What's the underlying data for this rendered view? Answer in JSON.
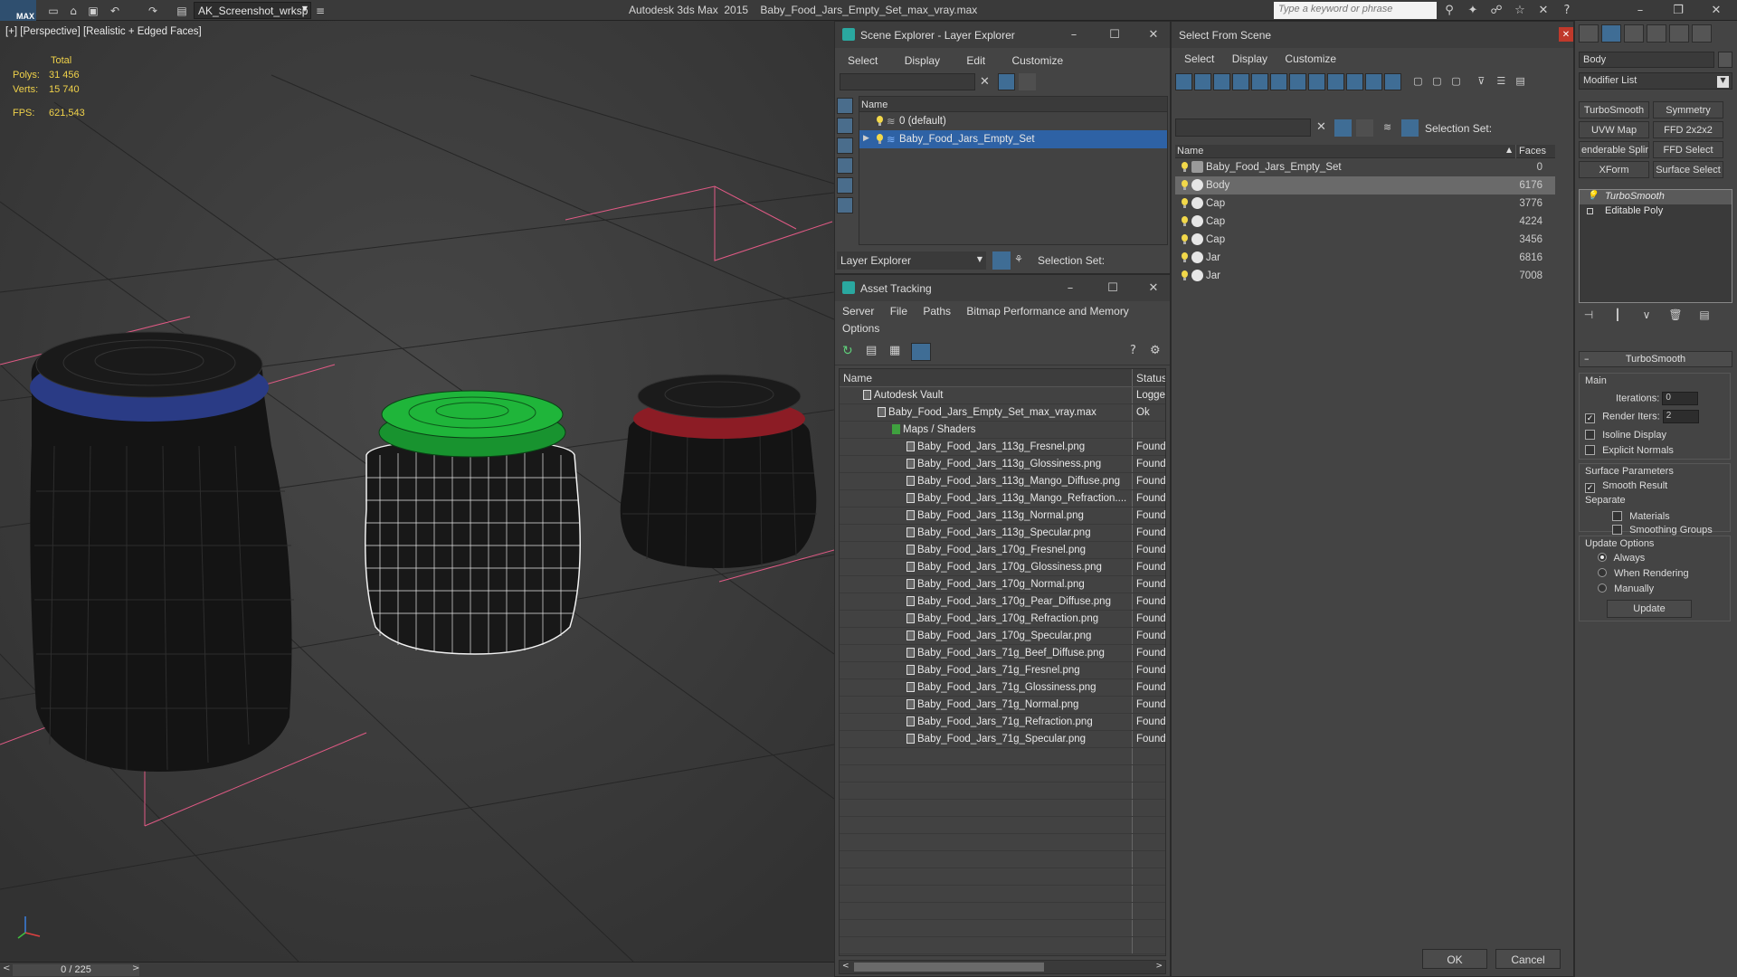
{
  "app": {
    "logo": "MAX",
    "window_title": "Autodesk 3ds Max  2015    Baby_Food_Jars_Empty_Set_max_vray.max",
    "workspace": "AK_Screenshot_wrksp",
    "search_placeholder": "Type a keyword or phrase"
  },
  "viewport": {
    "label": "[+] [Perspective] [Realistic + Edged Faces]",
    "stats": {
      "total_label": "Total",
      "polys_label": "Polys:",
      "polys": "31 456",
      "verts_label": "Verts:",
      "verts": "15 740",
      "fps_label": "FPS:",
      "fps": "621,543"
    },
    "timeline": "0 / 225"
  },
  "scene_explorer": {
    "title": "Scene Explorer - Layer Explorer",
    "menu": [
      "Select",
      "Display",
      "Edit",
      "Customize"
    ],
    "column_name": "Name",
    "layers": [
      {
        "label": "0 (default)",
        "selected": false
      },
      {
        "label": "Baby_Food_Jars_Empty_Set",
        "selected": true
      }
    ],
    "footer_dropdown": "Layer Explorer",
    "selection_set_label": "Selection Set:"
  },
  "asset_tracking": {
    "title": "Asset Tracking",
    "menu_row1": [
      "Server",
      "File",
      "Paths",
      "Bitmap Performance and Memory"
    ],
    "menu_row2": [
      "Options"
    ],
    "columns": {
      "name": "Name",
      "status": "Status"
    },
    "rows": [
      {
        "name": "Autodesk Vault",
        "status": "Logged",
        "level": 0
      },
      {
        "name": "Baby_Food_Jars_Empty_Set_max_vray.max",
        "status": "Ok",
        "level": 1
      },
      {
        "name": "Maps / Shaders",
        "status": "",
        "level": 2
      },
      {
        "name": "Baby_Food_Jars_113g_Fresnel.png",
        "status": "Found",
        "level": 3
      },
      {
        "name": "Baby_Food_Jars_113g_Glossiness.png",
        "status": "Found",
        "level": 3
      },
      {
        "name": "Baby_Food_Jars_113g_Mango_Diffuse.png",
        "status": "Found",
        "level": 3
      },
      {
        "name": "Baby_Food_Jars_113g_Mango_Refraction....",
        "status": "Found",
        "level": 3
      },
      {
        "name": "Baby_Food_Jars_113g_Normal.png",
        "status": "Found",
        "level": 3
      },
      {
        "name": "Baby_Food_Jars_113g_Specular.png",
        "status": "Found",
        "level": 3
      },
      {
        "name": "Baby_Food_Jars_170g_Fresnel.png",
        "status": "Found",
        "level": 3
      },
      {
        "name": "Baby_Food_Jars_170g_Glossiness.png",
        "status": "Found",
        "level": 3
      },
      {
        "name": "Baby_Food_Jars_170g_Normal.png",
        "status": "Found",
        "level": 3
      },
      {
        "name": "Baby_Food_Jars_170g_Pear_Diffuse.png",
        "status": "Found",
        "level": 3
      },
      {
        "name": "Baby_Food_Jars_170g_Refraction.png",
        "status": "Found",
        "level": 3
      },
      {
        "name": "Baby_Food_Jars_170g_Specular.png",
        "status": "Found",
        "level": 3
      },
      {
        "name": "Baby_Food_Jars_71g_Beef_Diffuse.png",
        "status": "Found",
        "level": 3
      },
      {
        "name": "Baby_Food_Jars_71g_Fresnel.png",
        "status": "Found",
        "level": 3
      },
      {
        "name": "Baby_Food_Jars_71g_Glossiness.png",
        "status": "Found",
        "level": 3
      },
      {
        "name": "Baby_Food_Jars_71g_Normal.png",
        "status": "Found",
        "level": 3
      },
      {
        "name": "Baby_Food_Jars_71g_Refraction.png",
        "status": "Found",
        "level": 3
      },
      {
        "name": "Baby_Food_Jars_71g_Specular.png",
        "status": "Found",
        "level": 3
      }
    ]
  },
  "select_from_scene": {
    "title": "Select From Scene",
    "menu": [
      "Select",
      "Display",
      "Customize"
    ],
    "selection_set_label": "Selection Set:",
    "columns": {
      "name": "Name",
      "faces": "Faces"
    },
    "rows": [
      {
        "name": "Baby_Food_Jars_Empty_Set",
        "faces": "0",
        "selected": false
      },
      {
        "name": "Body",
        "faces": "6176",
        "selected": true
      },
      {
        "name": "Cap",
        "faces": "3776",
        "selected": false
      },
      {
        "name": "Cap",
        "faces": "4224",
        "selected": false
      },
      {
        "name": "Cap",
        "faces": "3456",
        "selected": false
      },
      {
        "name": "Jar",
        "faces": "6816",
        "selected": false
      },
      {
        "name": "Jar",
        "faces": "7008",
        "selected": false
      }
    ],
    "ok_label": "OK",
    "cancel_label": "Cancel"
  },
  "command_panel": {
    "object_name": "Body",
    "modifier_list": "Modifier List",
    "modifier_buttons": [
      "TurboSmooth",
      "Symmetry",
      "UVW Map",
      "FFD 2x2x2",
      "enderable Splir",
      "FFD Select",
      "XForm",
      "Surface Select"
    ],
    "stack": [
      "TurboSmooth",
      "Editable Poly"
    ],
    "turbosmooth": {
      "title": "TurboSmooth",
      "main_label": "Main",
      "iterations_label": "Iterations:",
      "iterations": "0",
      "render_iters_label": "Render Iters:",
      "render_iters": "2",
      "isoline_label": "Isoline Display",
      "explicit_normals_label": "Explicit Normals",
      "surface_params_label": "Surface Parameters",
      "smooth_result_label": "Smooth Result",
      "separate_label": "Separate",
      "materials_label": "Materials",
      "smoothing_groups_label": "Smoothing Groups",
      "update_options_label": "Update Options",
      "always_label": "Always",
      "when_rendering_label": "When Rendering",
      "manually_label": "Manually",
      "update_label": "Update"
    }
  },
  "colors": {
    "selection_blue": "#2e62a5",
    "stats_yellow": "#f0d24a",
    "cap_blue": "#3a4fa0",
    "cap_green": "#1fa83c",
    "cap_red": "#a3202a",
    "close_red": "#c0392b"
  }
}
